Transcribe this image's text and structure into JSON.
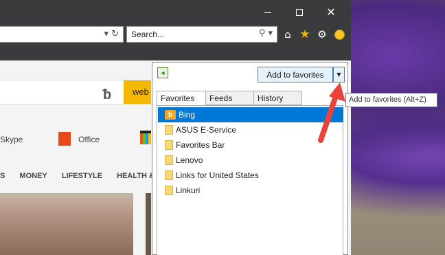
{
  "browser": {
    "search_placeholder": "Search...",
    "address_icons": "▾ ↻",
    "search_icons": "⚲ ▾"
  },
  "page": {
    "web_button": "web",
    "skype_label": "Skype",
    "office_label": "Office",
    "nav_tabs": [
      "S",
      "MONEY",
      "LIFESTYLE",
      "HEALTH & FI"
    ]
  },
  "favorites_center": {
    "add_button_label": "Add to favorites",
    "tabs": [
      "Favorites",
      "Feeds",
      "History"
    ],
    "items": [
      {
        "label": "Bing",
        "icon": "bing-icon",
        "selected": true
      },
      {
        "label": "ASUS E-Service",
        "icon": "folder-icon"
      },
      {
        "label": "Favorites Bar",
        "icon": "folder-icon"
      },
      {
        "label": "Lenovo",
        "icon": "folder-icon"
      },
      {
        "label": "Links for United States",
        "icon": "folder-icon"
      },
      {
        "label": "Linkuri",
        "icon": "folder-icon"
      }
    ]
  },
  "tooltip": "Add to favorites (Alt+Z)",
  "colors": {
    "titlebar": "#3a3b3d",
    "selection": "#0078d7",
    "star": "#f4b400",
    "arrow": "#e8423a"
  }
}
